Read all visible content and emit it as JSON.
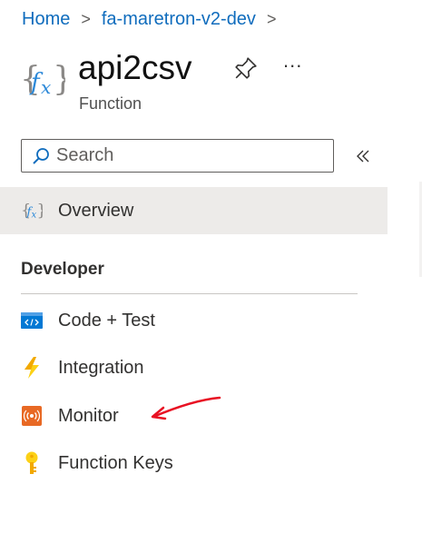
{
  "breadcrumb": {
    "items": [
      "Home",
      "fa-maretron-v2-dev"
    ],
    "separator": ">"
  },
  "header": {
    "title": "api2csv",
    "subtitle": "Function",
    "logo_text": "{fx}",
    "icon": "function-icon",
    "more_label": "..."
  },
  "search": {
    "placeholder": "Search",
    "value": ""
  },
  "nav": {
    "overview": {
      "label": "Overview",
      "icon": "function-icon",
      "selected": true
    },
    "section_title": "Developer",
    "items": [
      {
        "label": "Code + Test",
        "icon": "code-icon"
      },
      {
        "label": "Integration",
        "icon": "lightning-icon"
      },
      {
        "label": "Monitor",
        "icon": "monitor-icon"
      },
      {
        "label": "Function Keys",
        "icon": "key-icon"
      }
    ]
  },
  "colors": {
    "link": "#0f6cbd",
    "selected_bg": "#edebe9",
    "annotation": "#e81123"
  }
}
